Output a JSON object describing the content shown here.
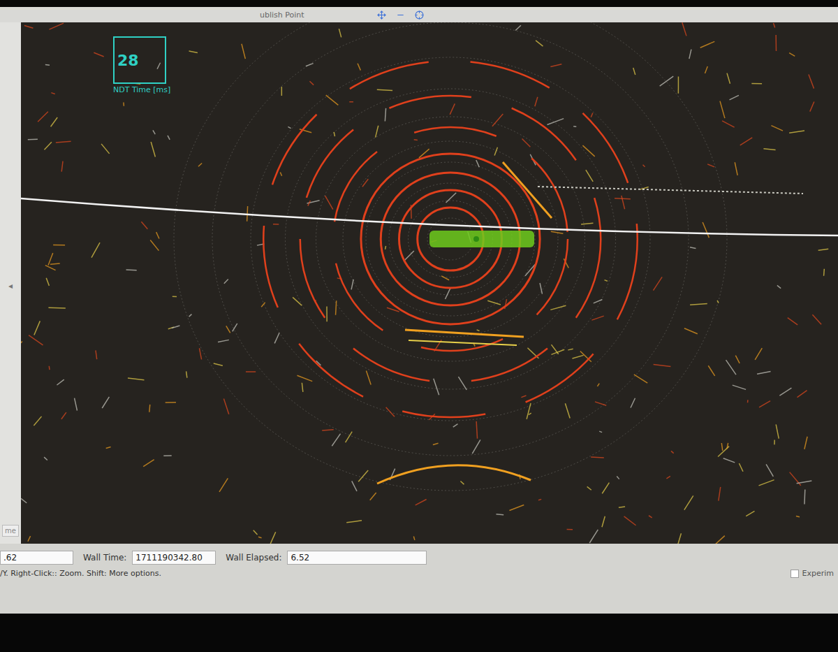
{
  "toolbar": {
    "tool": "ublish Point"
  },
  "overlay": {
    "value": "28",
    "title": "NDT Time [ms]"
  },
  "side_panel": {
    "arrow": "◂",
    "button": "me"
  },
  "status_bar": {
    "fields": [
      {
        "label": "",
        "value": ".62"
      },
      {
        "label": "Wall Time:",
        "value": "1711190342.80"
      },
      {
        "label": "Wall Elapsed:",
        "value": "6.52"
      }
    ],
    "hint": "/Y. Right-Click:: Zoom. Shift: More options.",
    "checkbox": {
      "label": "Experim",
      "checked": false
    }
  }
}
